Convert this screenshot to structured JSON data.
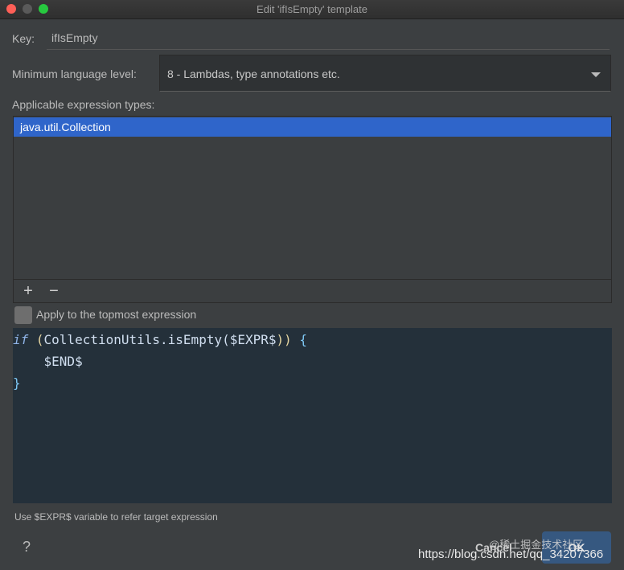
{
  "window": {
    "title": "Edit 'ifIsEmpty' template"
  },
  "key": {
    "label": "Key:",
    "value": "ifIsEmpty"
  },
  "language_level": {
    "label": "Minimum language level:",
    "selected": "8 - Lambdas, type annotations etc."
  },
  "expression_types": {
    "label": "Applicable expression types:",
    "items": [
      "java.util.Collection"
    ]
  },
  "list_toolbar": {
    "add": "+",
    "remove": "−"
  },
  "topmost": {
    "label": "Apply to the topmost expression"
  },
  "code": {
    "line1_kw": "if",
    "line1_paren_open": " (",
    "line1_call": "CollectionUtils.isEmpty(",
    "line1_expr": "$EXPR$",
    "line1_close": "))",
    "line1_brace": " {",
    "line2": "    $END$",
    "line3": "}"
  },
  "hint": "Use $EXPR$ variable to refer target expression",
  "help": "?",
  "buttons": {
    "cancel": "Cancel",
    "ok": "OK"
  },
  "watermark": {
    "site": "@稀土掘金技术社区",
    "url": "https://blog.csdn.net/qq_34207366"
  },
  "colors": {
    "selection": "#2f65ca",
    "editor_bg": "#24303a",
    "dialog_bg": "#3c3f41",
    "ok_button": "#365880"
  }
}
